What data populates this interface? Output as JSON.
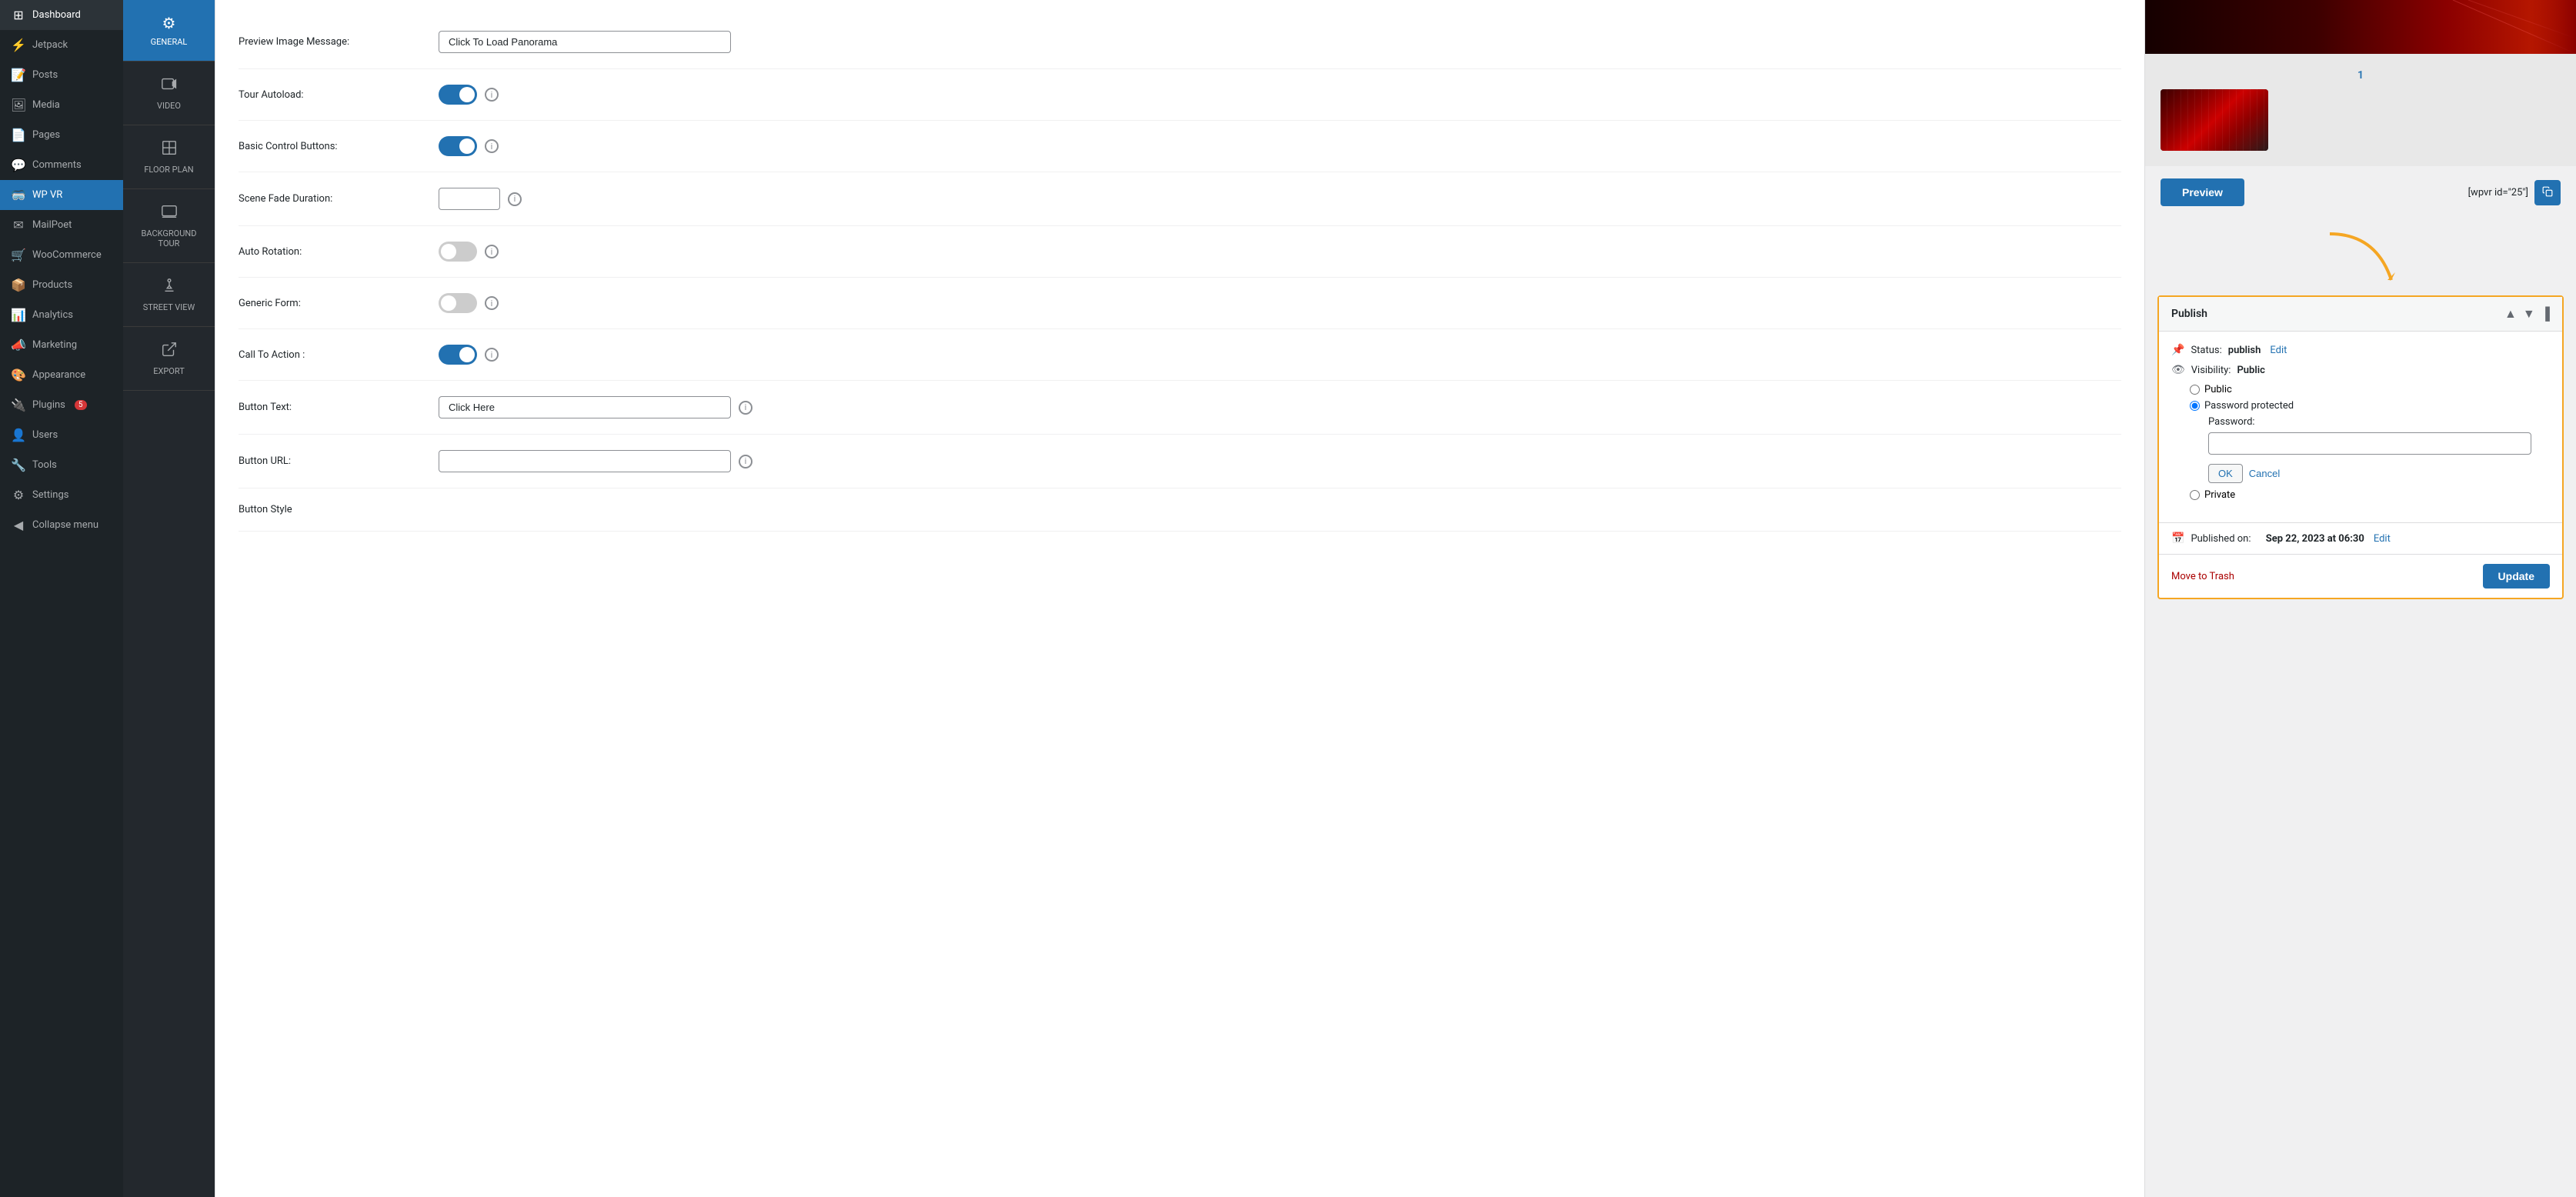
{
  "sidebar": {
    "items": [
      {
        "id": "dashboard",
        "label": "Dashboard",
        "icon": "⊞"
      },
      {
        "id": "jetpack",
        "label": "Jetpack",
        "icon": "⚡"
      },
      {
        "id": "posts",
        "label": "Posts",
        "icon": "📝"
      },
      {
        "id": "media",
        "label": "Media",
        "icon": "🖼"
      },
      {
        "id": "pages",
        "label": "Pages",
        "icon": "📄"
      },
      {
        "id": "comments",
        "label": "Comments",
        "icon": "💬"
      },
      {
        "id": "wpvr",
        "label": "WP VR",
        "icon": "🥽"
      },
      {
        "id": "mailpoet",
        "label": "MailPoet",
        "icon": "✉"
      },
      {
        "id": "woocommerce",
        "label": "WooCommerce",
        "icon": "🛒"
      },
      {
        "id": "products",
        "label": "Products",
        "icon": "📦"
      },
      {
        "id": "analytics",
        "label": "Analytics",
        "icon": "📊"
      },
      {
        "id": "marketing",
        "label": "Marketing",
        "icon": "📣"
      },
      {
        "id": "appearance",
        "label": "Appearance",
        "icon": "🎨"
      },
      {
        "id": "plugins",
        "label": "Plugins",
        "icon": "🔌",
        "badge": "5"
      },
      {
        "id": "users",
        "label": "Users",
        "icon": "👤"
      },
      {
        "id": "tools",
        "label": "Tools",
        "icon": "🔧"
      },
      {
        "id": "settings",
        "label": "Settings",
        "icon": "⚙"
      },
      {
        "id": "collapse",
        "label": "Collapse menu",
        "icon": "◀"
      }
    ]
  },
  "subnav": {
    "items": [
      {
        "id": "general",
        "label": "GENERAL",
        "icon": "⚙",
        "active": true
      },
      {
        "id": "video",
        "label": "VIDEO",
        "icon": "🎬"
      },
      {
        "id": "floorplan",
        "label": "FLOOR PLAN",
        "icon": "🗺"
      },
      {
        "id": "background_tour",
        "label": "BACKGROUND TOUR",
        "icon": "🖥"
      },
      {
        "id": "street_view",
        "label": "STREET VIEW",
        "icon": "🗺"
      },
      {
        "id": "export",
        "label": "EXPORT",
        "icon": "↗"
      }
    ]
  },
  "settings": {
    "fields": [
      {
        "id": "preview_image_message",
        "label": "Preview Image Message:",
        "type": "text",
        "value": "Click To Load Panorama",
        "placeholder": "Click To Load Panorama"
      },
      {
        "id": "tour_autoload",
        "label": "Tour Autoload:",
        "type": "toggle",
        "value": true
      },
      {
        "id": "basic_control_buttons",
        "label": "Basic Control Buttons:",
        "type": "toggle",
        "value": true
      },
      {
        "id": "scene_fade_duration",
        "label": "Scene Fade Duration:",
        "type": "small_text",
        "value": ""
      },
      {
        "id": "auto_rotation",
        "label": "Auto Rotation:",
        "type": "toggle",
        "value": false
      },
      {
        "id": "generic_form",
        "label": "Generic Form:",
        "type": "toggle",
        "value": false
      },
      {
        "id": "call_to_action",
        "label": "Call To Action :",
        "type": "toggle",
        "value": true
      },
      {
        "id": "button_text",
        "label": "Button Text:",
        "type": "text",
        "value": "Click Here",
        "placeholder": "Click Here"
      },
      {
        "id": "button_url",
        "label": "Button URL:",
        "type": "text",
        "value": "",
        "placeholder": ""
      },
      {
        "id": "button_style",
        "label": "Button Style",
        "type": "text",
        "value": ""
      }
    ]
  },
  "right_panel": {
    "panorama_number": "1",
    "preview_button": "Preview",
    "shortcode": "[wpvr id=\"25\"]",
    "publish_box": {
      "title": "Publish",
      "status_label": "Status:",
      "status_value": "publish",
      "status_edit": "Edit",
      "visibility_label": "Visibility:",
      "visibility_value": "Public",
      "visibility_options": [
        {
          "id": "public",
          "label": "Public",
          "selected": false
        },
        {
          "id": "password_protected",
          "label": "Password protected",
          "selected": true
        },
        {
          "id": "private",
          "label": "Private",
          "selected": false
        }
      ],
      "password_label": "Password:",
      "password_value": "",
      "ok_label": "OK",
      "cancel_label": "Cancel",
      "published_on_label": "Published on:",
      "published_on_value": "Sep 22, 2023 at 06:30",
      "published_on_edit": "Edit",
      "move_trash": "Move to Trash",
      "update_label": "Update"
    }
  }
}
